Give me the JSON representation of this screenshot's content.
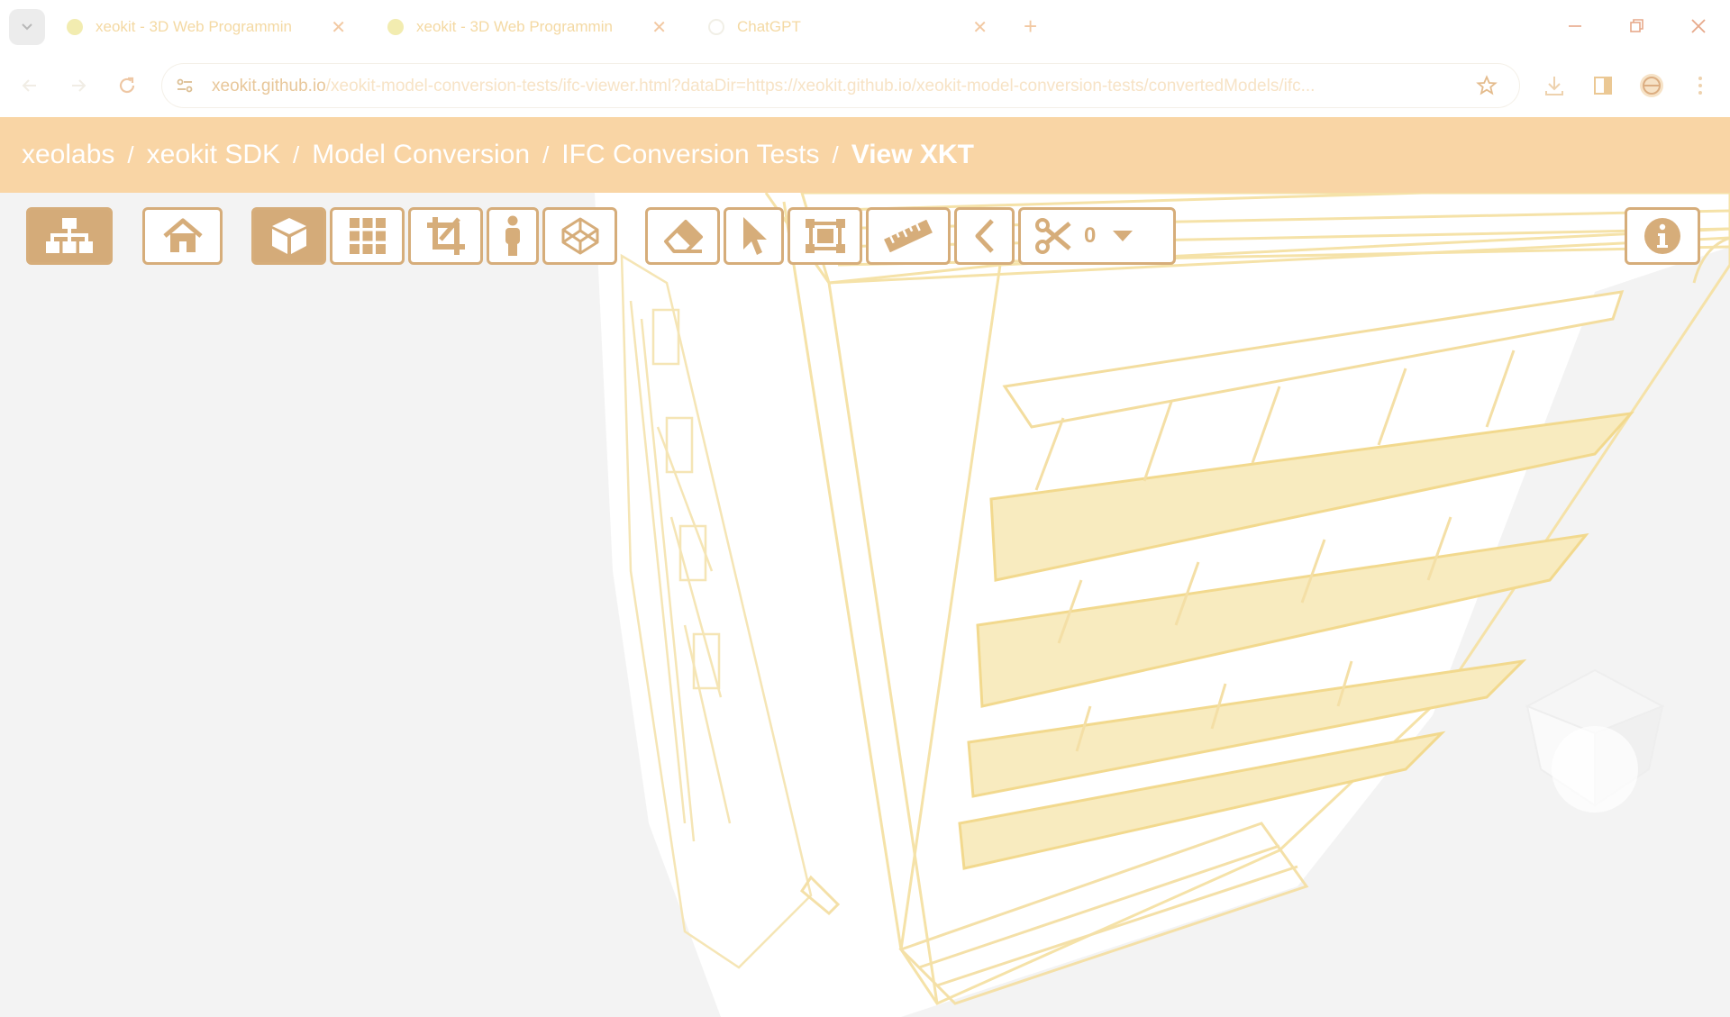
{
  "browser": {
    "tabs": [
      {
        "title": "xeokit - 3D Web Programmin",
        "active": false
      },
      {
        "title": "xeokit - 3D Web Programmin",
        "active": true
      },
      {
        "title": "ChatGPT",
        "active": false
      }
    ],
    "url_host": "xeokit.github.io",
    "url_path": "/xeokit-model-conversion-tests/ifc-viewer.html?dataDir=https://xeokit.github.io/xeokit-model-conversion-tests/convertedModels/ifc..."
  },
  "breadcrumb": {
    "items": [
      "xeolabs",
      "xeokit SDK",
      "Model Conversion",
      "IFC Conversion Tests",
      "View XKT"
    ],
    "separator": "/"
  },
  "toolbar": {
    "section_count": "0",
    "buttons": [
      {
        "icon": "sitemap-icon",
        "active": true
      },
      {
        "icon": "home-icon",
        "active": false
      },
      {
        "icon": "cube-icon",
        "active": true
      },
      {
        "icon": "grid-icon",
        "active": false
      },
      {
        "icon": "crop-icon",
        "active": false
      },
      {
        "icon": "person-icon",
        "active": false
      },
      {
        "icon": "codepen-icon",
        "active": false
      },
      {
        "icon": "eraser-icon",
        "active": false
      },
      {
        "icon": "cursor-icon",
        "active": false
      },
      {
        "icon": "marquee-icon",
        "active": false
      },
      {
        "icon": "ruler-icon",
        "active": false
      },
      {
        "icon": "angle-icon",
        "active": false
      },
      {
        "icon": "scissors-icon",
        "active": false
      },
      {
        "icon": "info-icon",
        "active": false
      }
    ]
  },
  "colors": {
    "accent": "#d6ad7a",
    "header": "#f9d5a5",
    "model_line": "#f5e2a8",
    "model_fill": "#f6e6b8"
  }
}
